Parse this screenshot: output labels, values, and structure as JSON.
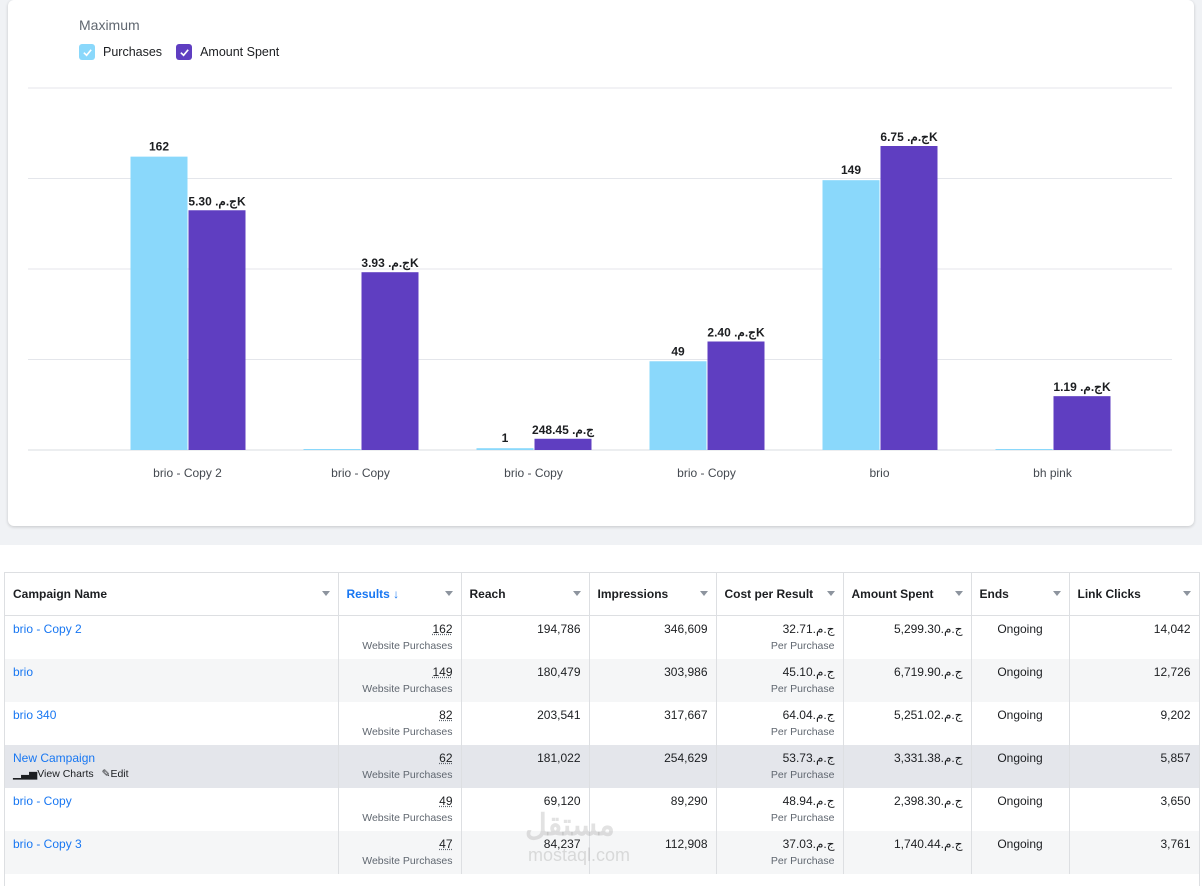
{
  "legend": {
    "title": "Maximum",
    "items": [
      {
        "label": "Purchases",
        "color": "#8ad8fb"
      },
      {
        "label": "Amount Spent",
        "color": "#5f3ec1"
      }
    ]
  },
  "chart_data": {
    "type": "bar",
    "title": "",
    "xlabel": "",
    "ylabel": "",
    "categories": [
      "brio - Copy 2",
      "brio - Copy",
      "brio - Copy",
      "brio - Copy",
      "brio",
      "bh pink"
    ],
    "series": [
      {
        "name": "Purchases",
        "color": "#8ad8fb",
        "values": [
          162,
          0,
          1,
          49,
          149,
          0
        ],
        "labels": [
          "162",
          "",
          "1",
          "49",
          "149",
          ""
        ]
      },
      {
        "name": "Amount Spent",
        "color": "#5f3ec1",
        "values": [
          5299.3,
          3930,
          248.45,
          2398.3,
          6719.9,
          1190
        ],
        "labels": [
          "ج.م. 5.30K",
          "ج.م. 3.93K",
          "ج.م. 248.45",
          "ج.م. 2.40K",
          "ج.م. 6.75K",
          "ج.م. 1.19K"
        ]
      }
    ],
    "grid": true,
    "legend_position": "top-left"
  },
  "table": {
    "columns": [
      "Campaign Name",
      "Results ↓",
      "Reach",
      "Impressions",
      "Cost per Result",
      "Amount Spent",
      "Ends",
      "Link Clicks"
    ],
    "rows": [
      {
        "name": "brio - Copy 2",
        "results": "162",
        "results_sub": "Website Purchases",
        "reach": "194,786",
        "impressions": "346,609",
        "cpr": "ج.م.32.71",
        "cpr_sub": "Per Purchase",
        "spent": "ج.م.5,299.30",
        "ends": "Ongoing",
        "clicks": "14,042"
      },
      {
        "name": "brio",
        "results": "149",
        "results_sub": "Website Purchases",
        "reach": "180,479",
        "impressions": "303,986",
        "cpr": "ج.م.45.10",
        "cpr_sub": "Per Purchase",
        "spent": "ج.م.6,719.90",
        "ends": "Ongoing",
        "clicks": "12,726"
      },
      {
        "name": "brio 340",
        "results": "82",
        "results_sub": "Website Purchases",
        "reach": "203,541",
        "impressions": "317,667",
        "cpr": "ج.م.64.04",
        "cpr_sub": "Per Purchase",
        "spent": "ج.م.5,251.02",
        "ends": "Ongoing",
        "clicks": "9,202"
      },
      {
        "name": "New Campaign",
        "results": "62",
        "results_sub": "Website Purchases",
        "reach": "181,022",
        "impressions": "254,629",
        "cpr": "ج.م.53.73",
        "cpr_sub": "Per Purchase",
        "spent": "ج.م.3,331.38",
        "ends": "Ongoing",
        "clicks": "5,857",
        "actions": [
          "View Charts",
          "Edit"
        ]
      },
      {
        "name": "brio - Copy",
        "results": "49",
        "results_sub": "Website Purchases",
        "reach": "69,120",
        "impressions": "89,290",
        "cpr": "ج.م.48.94",
        "cpr_sub": "Per Purchase",
        "spent": "ج.م.2,398.30",
        "ends": "Ongoing",
        "clicks": "3,650"
      },
      {
        "name": "brio - Copy 3",
        "results": "47",
        "results_sub": "Website Purchases",
        "reach": "84,237",
        "impressions": "112,908",
        "cpr": "ج.م.37.03",
        "cpr_sub": "Per Purchase",
        "spent": "ج.م.1,740.44",
        "ends": "Ongoing",
        "clicks": "3,761"
      }
    ]
  },
  "watermark": {
    "logo": "مستقل",
    "text": "mostaql.com"
  }
}
